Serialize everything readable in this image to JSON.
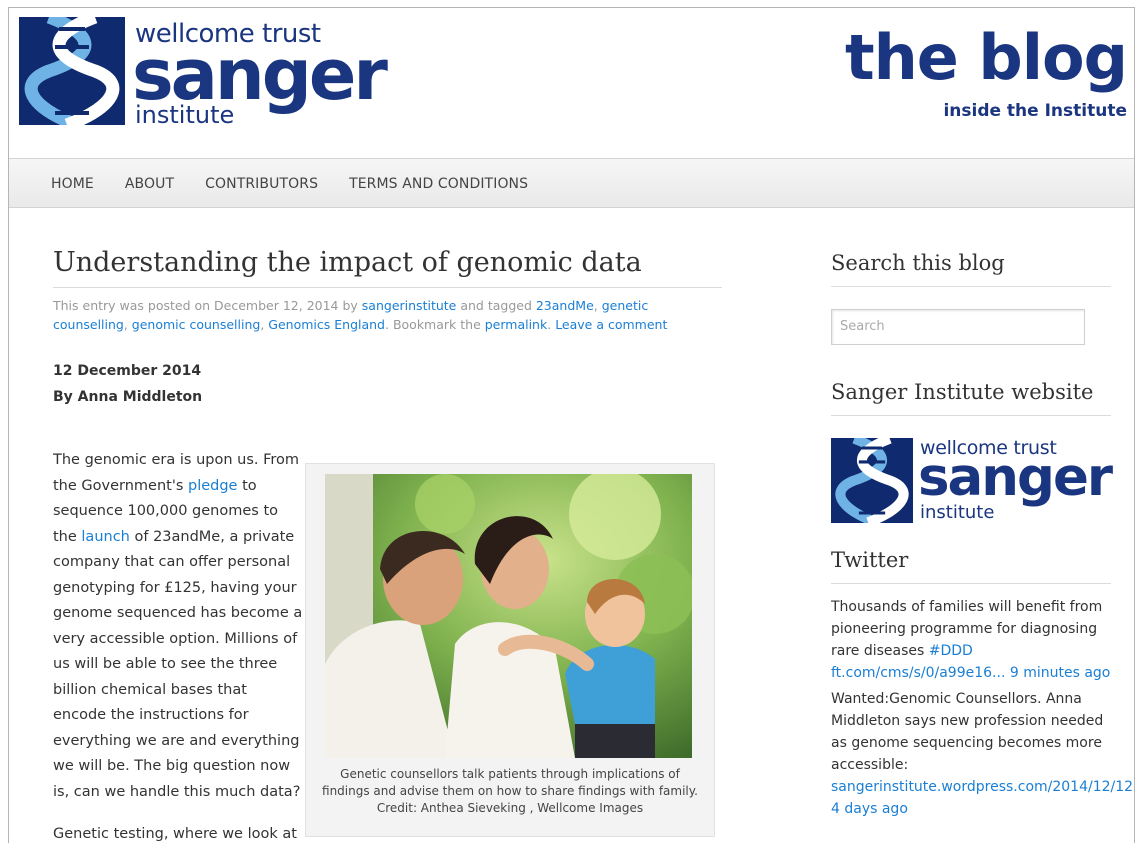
{
  "header": {
    "logo": {
      "line1": "wellcome trust",
      "line2": "sanger",
      "line3": "institute"
    },
    "blog_title": "the blog",
    "blog_subtitle": "inside the Institute"
  },
  "nav": {
    "items": [
      "HOME",
      "ABOUT",
      "CONTRIBUTORS",
      "TERMS AND CONDITIONS"
    ]
  },
  "post": {
    "title": "Understanding the impact of genomic data",
    "meta": {
      "prefix": "This entry was posted on December 12, 2014 by ",
      "author_link": "sangerinstitute",
      "tagged_text": " and tagged ",
      "tags": [
        "23andMe",
        "genetic counselling",
        "genomic counselling",
        "Genomics England"
      ],
      "bookmark_text": ". Bookmark the ",
      "permalink": "permalink",
      "leave_comment": "Leave a comment"
    },
    "date": "12 December 2014",
    "byline": "By Anna Middleton",
    "para1": {
      "t1": "The genomic era is upon us. From the Government's ",
      "link1": "pledge",
      "t2": " to sequence 100,000 genomes to the ",
      "link2": "launch",
      "t3": " of 23andMe, a private company that can offer personal genotyping for £125, having your genome sequenced has become a very accessible option. Millions of us will be able to see the three billion chemical bases that encode the instructions for everything we are and everything we will be. The big question now is, can we handle this much data?"
    },
    "para2": "Genetic testing, where we look at",
    "figure_caption": "Genetic counsellors talk patients through implications of findings and advise them on how to share findings with family. Credit: Anthea Sieveking , Wellcome Images"
  },
  "sidebar": {
    "search_title": "Search this blog",
    "search_placeholder": "Search",
    "website_title": "Sanger Institute website",
    "twitter_title": "Twitter",
    "tweets": [
      {
        "text": "Thousands of families will benefit from pioneering programme for diagnosing rare diseases ",
        "link": "#DDD ft.com/cms/s/0/a99e16... 9 minutes ago"
      },
      {
        "text": "Wanted:Genomic Counsellors. Anna Middleton says new profession needed as genome sequencing becomes more accessible: ",
        "link": "sangerinstitute.wordpress.com/2014/12/12 4 days ago"
      }
    ]
  },
  "colors": {
    "brand_navy": "#1a3680",
    "link_blue": "#1a7fd4"
  },
  "icons": [
    "dna-helix-logo-icon"
  ]
}
